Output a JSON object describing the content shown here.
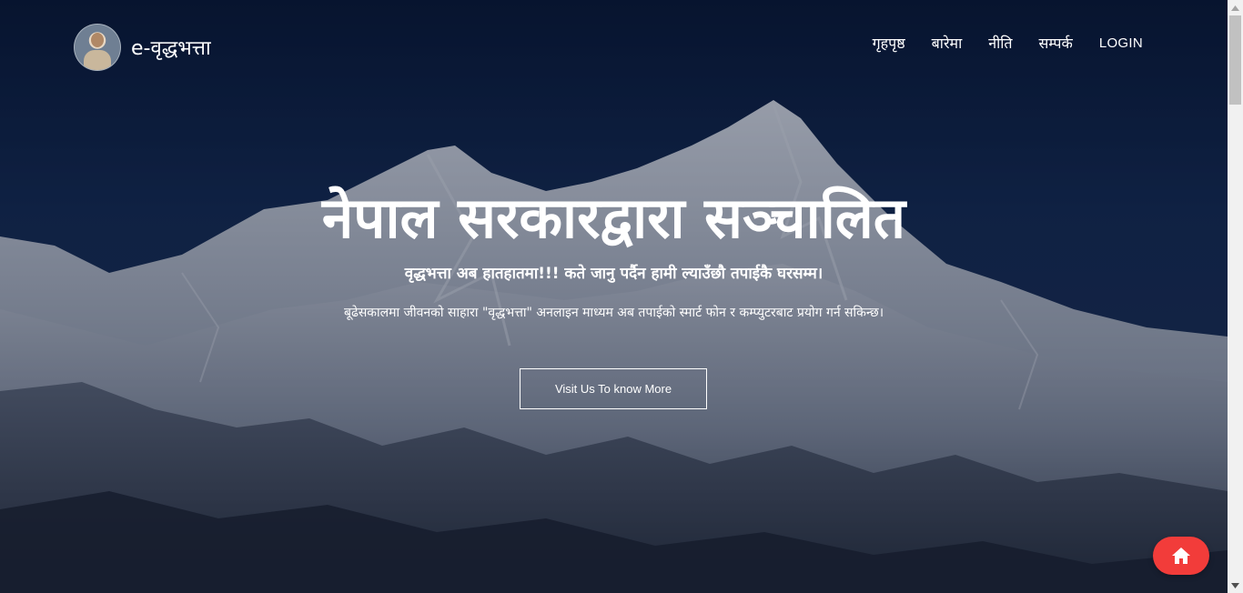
{
  "navbar": {
    "brand_name": "e-वृद्धभत्ता",
    "avatar_icon": "profile-photo-icon",
    "menu": [
      {
        "label": "गृहपृष्ठ"
      },
      {
        "label": "बारेमा"
      },
      {
        "label": "नीति"
      },
      {
        "label": "सम्पर्क"
      },
      {
        "label": "LOGIN"
      }
    ]
  },
  "hero": {
    "headline": "नेपाल सरकारद्वारा सञ्चालित",
    "subline": "वृद्धभत्ता अब हातहातमा!!! कते जानु पर्दैन हामी ल्याउँछौ तपाईकै घरसम्म।",
    "description": "बूढेसकालमा जीवनको साहारा \"वृद्धभत्ता\" अनलाइन माध्यम अब तपाईको स्मार्ट फोन र कम्प्युटरबाट प्रयोग गर्न सकिन्छ।",
    "cta_label": "Visit Us To know More"
  },
  "floating_button": {
    "icon": "home-icon",
    "color": "#f23c3a"
  },
  "colors": {
    "hero_overlay": "#0a1a3a",
    "text": "#ffffff"
  }
}
